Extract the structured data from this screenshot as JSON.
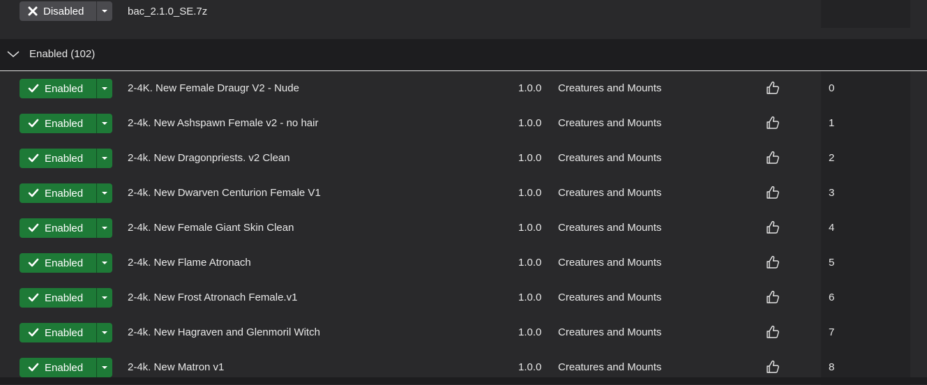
{
  "top_row": {
    "status_label": "Disabled",
    "name": "bac_2.1.0_SE.7z"
  },
  "group": {
    "label": "Enabled (102)"
  },
  "rows": [
    {
      "status": "Enabled",
      "name": "2-4K. New Female Draugr V2 - Nude",
      "version": "1.0.0",
      "category": "Creatures and Mounts",
      "rank": "0"
    },
    {
      "status": "Enabled",
      "name": "2-4k. New Ashspawn Female v2 - no hair",
      "version": "1.0.0",
      "category": "Creatures and Mounts",
      "rank": "1"
    },
    {
      "status": "Enabled",
      "name": "2-4k. New Dragonpriests. v2 Clean",
      "version": "1.0.0",
      "category": "Creatures and Mounts",
      "rank": "2"
    },
    {
      "status": "Enabled",
      "name": "2-4k. New Dwarven Centurion Female V1",
      "version": "1.0.0",
      "category": "Creatures and Mounts",
      "rank": "3"
    },
    {
      "status": "Enabled",
      "name": "2-4k. New Female Giant Skin Clean",
      "version": "1.0.0",
      "category": "Creatures and Mounts",
      "rank": "4"
    },
    {
      "status": "Enabled",
      "name": "2-4k. New Flame Atronach",
      "version": "1.0.0",
      "category": "Creatures and Mounts",
      "rank": "5"
    },
    {
      "status": "Enabled",
      "name": "2-4k. New Frost Atronach Female.v1",
      "version": "1.0.0",
      "category": "Creatures and Mounts",
      "rank": "6"
    },
    {
      "status": "Enabled",
      "name": "2-4k. New Hagraven and Glenmoril Witch",
      "version": "1.0.0",
      "category": "Creatures and Mounts",
      "rank": "7"
    },
    {
      "status": "Enabled",
      "name": "2-4k. New Matron v1",
      "version": "1.0.0",
      "category": "Creatures and Mounts",
      "rank": "8"
    }
  ],
  "colors": {
    "enabled_green": "#1e7a37",
    "disabled_gray": "#4a4a4e",
    "background": "#29292b",
    "header_bg": "#1d1d1f"
  },
  "icons": {
    "enabled": "checkmark-icon",
    "disabled": "x-icon",
    "dropdown": "caret-down-icon",
    "endorse": "thumbs-up-icon",
    "group_toggle": "chevron-down-icon"
  }
}
